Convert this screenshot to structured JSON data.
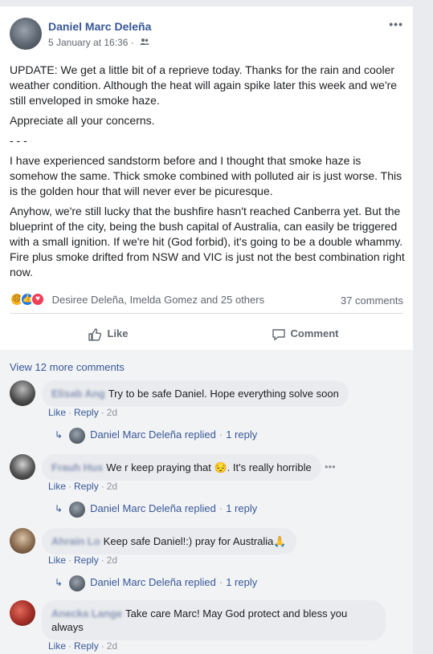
{
  "post": {
    "author": "Daniel Marc Deleña",
    "timestamp": "5 January at 16:36",
    "audience_icon": "friends-icon",
    "more_icon": "more-dots-icon",
    "paragraphs": [
      "UPDATE: We get a little bit of a reprieve today. Thanks for the rain and cooler weather condition. Although the heat will again spike later this week and we're still enveloped in smoke haze.",
      "Appreciate all your concerns.",
      "- - -",
      "I have experienced sandstorm before and I thought that smoke haze is somehow the same. Thick smoke combined with polluted air is just worse. This is the golden hour that will never ever be picuresque.",
      "Anyhow, we're still lucky that the bushfire hasn't reached Canberra yet. But the blueprint of the city, being the bush capital of Australia, can easily be triggered with a small ignition. If we're hit (God forbid), it's going to be a double whammy. Fire plus smoke drifted from NSW and VIC is just not the best combination right now."
    ],
    "reactions": [
      "sad",
      "like",
      "love"
    ],
    "reactors_text": "Desiree Deleña, Imelda Gomez and 25 others",
    "comment_count": "37 comments",
    "like_label": "Like",
    "comment_label": "Comment"
  },
  "comments": {
    "view_more": "View 12 more comments",
    "items": [
      {
        "author_blurred": "Elisab Ang",
        "text": "Try to be safe Daniel. Hope everything solve soon",
        "like": "Like",
        "reply": "Reply",
        "time": "2d",
        "reply_text": "Daniel Marc Deleña replied",
        "reply_count": "1 reply"
      },
      {
        "author_blurred": "Frauh Hus",
        "text": "We r keep praying that 😔. It's really horrible",
        "like": "Like",
        "reply": "Reply",
        "time": "2d",
        "reply_text": "Daniel Marc Deleña replied",
        "reply_count": "1 reply"
      },
      {
        "author_blurred": "Ahrain Lo",
        "text": "Keep safe Daniel!:) pray for Australia🙏",
        "like": "Like",
        "reply": "Reply",
        "time": "2d",
        "reply_text": "Daniel Marc Deleña replied",
        "reply_count": "1 reply"
      },
      {
        "author_blurred": "Anecka Lange",
        "text": "Take care Marc! May God protect and bless you always",
        "like": "Like",
        "reply": "Reply",
        "time": "2d"
      }
    ]
  },
  "colors": {
    "link": "#385898",
    "muted": "#616770",
    "bubble": "#e9ebee"
  }
}
